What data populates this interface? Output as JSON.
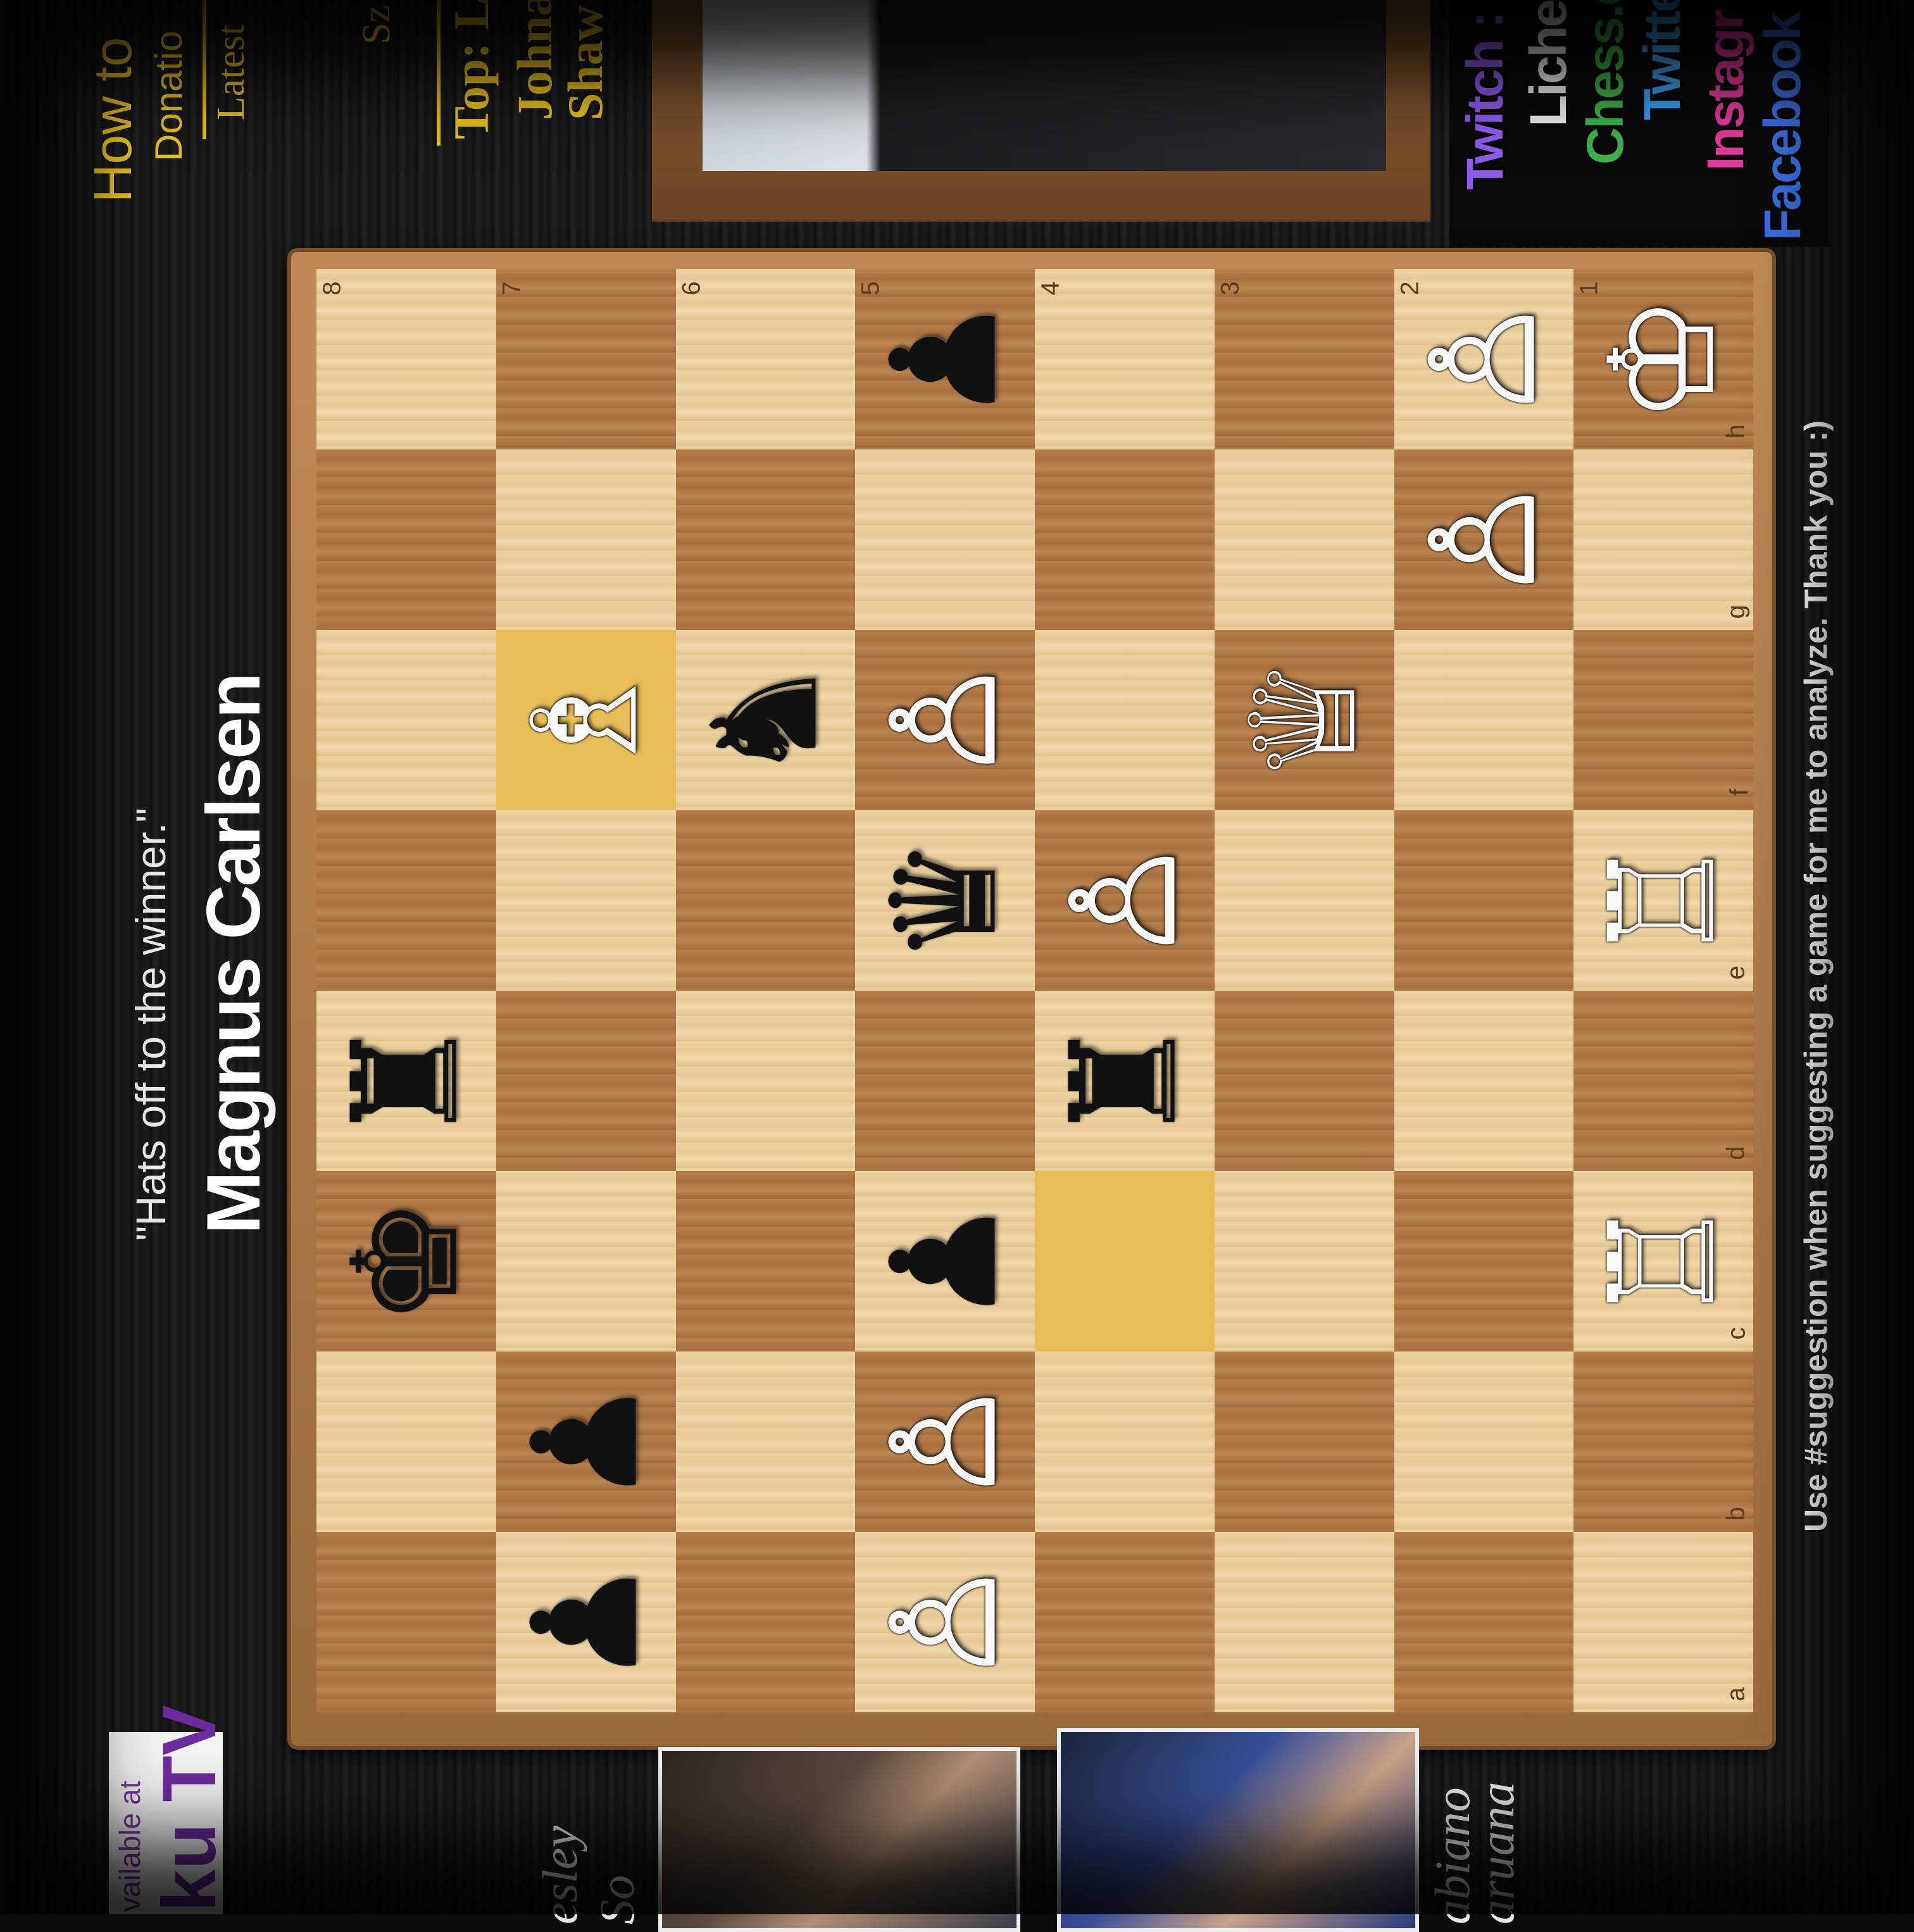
{
  "header": {
    "quote": "\"Hats off to the winner.\"",
    "winner": "Magnus Carlsen"
  },
  "footer": {
    "suggestion": "Use #suggestion when suggesting a game for me to analyze. Thank you :)"
  },
  "roku": {
    "available": "vailable at",
    "brand": "ku TV"
  },
  "players": [
    {
      "name_line1": "esley",
      "name_line2": "So"
    },
    {
      "name_line1": "abiano",
      "name_line2": "aruana"
    }
  ],
  "top_panel": {
    "line1": "How to",
    "line2": "Donatio",
    "line3": "Latest",
    "line4": "Sz",
    "line5": "Top: L",
    "line6": "Johna",
    "line7": "Shaw"
  },
  "social": [
    "Twitch :",
    "Liches",
    "Chess.c",
    "Twitte",
    "Instagr",
    "Facebook :"
  ],
  "colors": {
    "accent_yellow": "#e8c21e",
    "highlight": "#f4d476"
  },
  "board": {
    "ranks": [
      "8",
      "7",
      "6",
      "5",
      "4",
      "3",
      "2",
      "1"
    ],
    "files": [
      "a",
      "b",
      "c",
      "d",
      "e",
      "f",
      "g",
      "h"
    ],
    "highlighted_squares": [
      "f7",
      "c4"
    ],
    "pieces": {
      "h1": "♔",
      "g2": "♙",
      "h2": "♙",
      "f3": "♕",
      "e4": "♙",
      "d4": "♜",
      "a5": "♙",
      "b5": "♙",
      "c5": "♟",
      "e5": "♛",
      "f5": "♙",
      "h5": "♟",
      "f6": "♞",
      "a7": "♟",
      "b7": "♟",
      "f7": "♗",
      "c8": "♚",
      "d8": "♜",
      "c1": "♖",
      "e1": "♖"
    },
    "piece_colors": {
      "h1": "w",
      "g2": "w",
      "h2": "w",
      "f3": "w",
      "e4": "w",
      "d4": "b",
      "a5": "w",
      "b5": "w",
      "c5": "b",
      "e5": "b",
      "f5": "w",
      "h5": "b",
      "f6": "b",
      "a7": "b",
      "b7": "b",
      "f7": "w",
      "c8": "b",
      "d8": "b",
      "c1": "w",
      "e1": "w"
    }
  }
}
